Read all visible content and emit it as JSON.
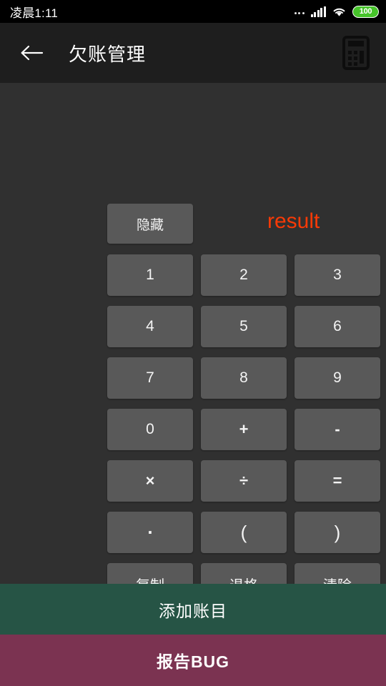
{
  "status_bar": {
    "time": "凌晨1:11",
    "battery_level": "100",
    "icons": [
      "more-dots-icon",
      "signal-icon",
      "wifi-icon",
      "battery-icon"
    ],
    "battery_color": "#46c32a"
  },
  "app_bar": {
    "back_icon": "back-arrow-icon",
    "title": "欠账管理",
    "action_icon": "calculator-icon"
  },
  "calculator": {
    "hide_label": "隐藏",
    "result_text": "result",
    "result_color": "#f93a06",
    "rows": [
      [
        {
          "label": "1",
          "kind": "num"
        },
        {
          "label": "2",
          "kind": "num"
        },
        {
          "label": "3",
          "kind": "num"
        }
      ],
      [
        {
          "label": "4",
          "kind": "num"
        },
        {
          "label": "5",
          "kind": "num"
        },
        {
          "label": "6",
          "kind": "num"
        }
      ],
      [
        {
          "label": "7",
          "kind": "num"
        },
        {
          "label": "8",
          "kind": "num"
        },
        {
          "label": "9",
          "kind": "num"
        }
      ],
      [
        {
          "label": "0",
          "kind": "num"
        },
        {
          "label": "+",
          "kind": "op"
        },
        {
          "label": "-",
          "kind": "op"
        }
      ],
      [
        {
          "label": "×",
          "kind": "op"
        },
        {
          "label": "÷",
          "kind": "op"
        },
        {
          "label": "=",
          "kind": "op"
        }
      ],
      [
        {
          "label": ".",
          "kind": "dot"
        },
        {
          "label": "(",
          "kind": "paren"
        },
        {
          "label": ")",
          "kind": "paren"
        }
      ],
      [
        {
          "label": "复制",
          "kind": "cjk"
        },
        {
          "label": "退格",
          "kind": "cjk"
        },
        {
          "label": "清除",
          "kind": "cjk"
        }
      ]
    ],
    "key_color": "#595959"
  },
  "bottom": {
    "add_label": "添加账目",
    "add_color": "#265445",
    "bug_label": "报告BUG",
    "bug_color": "#7b3351"
  }
}
